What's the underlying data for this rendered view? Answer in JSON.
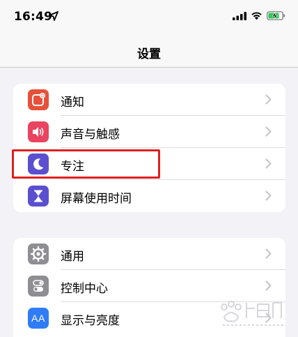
{
  "status_bar": {
    "time": "16:49"
  },
  "nav": {
    "title": "设置"
  },
  "group1": [
    {
      "label": "通知",
      "icon": "notifications-icon",
      "color": "#e8503a"
    },
    {
      "label": "声音与触感",
      "icon": "speaker-icon",
      "color": "#e94560"
    },
    {
      "label": "专注",
      "icon": "moon-icon",
      "color": "#5b4fd0"
    },
    {
      "label": "屏幕使用时间",
      "icon": "hourglass-icon",
      "color": "#5b4fd0"
    }
  ],
  "group2": [
    {
      "label": "通用",
      "icon": "gear-icon",
      "color": "#8e8e93"
    },
    {
      "label": "控制中心",
      "icon": "toggles-icon",
      "color": "#8e8e93"
    },
    {
      "label": "显示与亮度",
      "icon": "text-size-icon",
      "color": "#2f7cf6",
      "glyph": "AA"
    }
  ],
  "highlight_color": "#e02020"
}
